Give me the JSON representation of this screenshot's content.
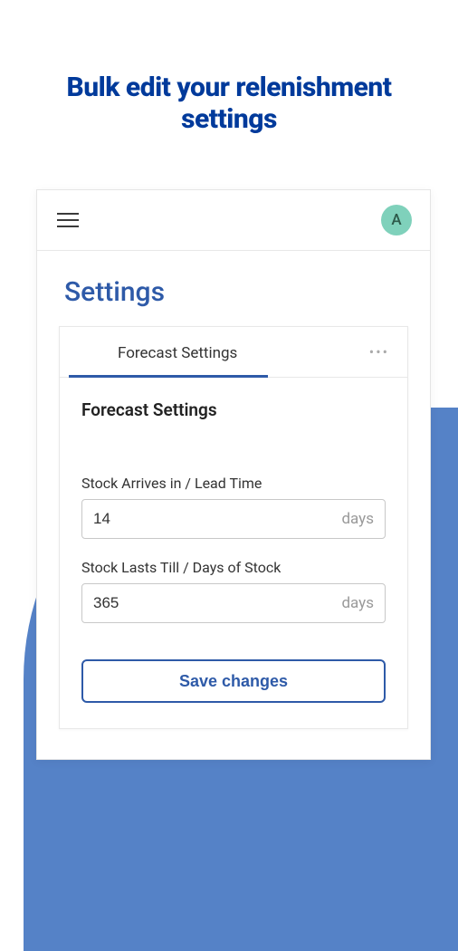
{
  "headline": {
    "line": "Bulk edit your relenishment settings"
  },
  "header": {
    "avatar_initial": "A"
  },
  "page": {
    "title": "Settings"
  },
  "tabs": {
    "active": "Forecast Settings",
    "more": "•••"
  },
  "section": {
    "heading": "Forecast Settings"
  },
  "fields": {
    "lead_time": {
      "label": "Stock Arrives in / Lead Time",
      "value": "14",
      "unit": "days"
    },
    "days_of_stock": {
      "label": "Stock Lasts Till / Days of Stock",
      "value": "365",
      "unit": "days"
    }
  },
  "actions": {
    "save": "Save changes"
  }
}
